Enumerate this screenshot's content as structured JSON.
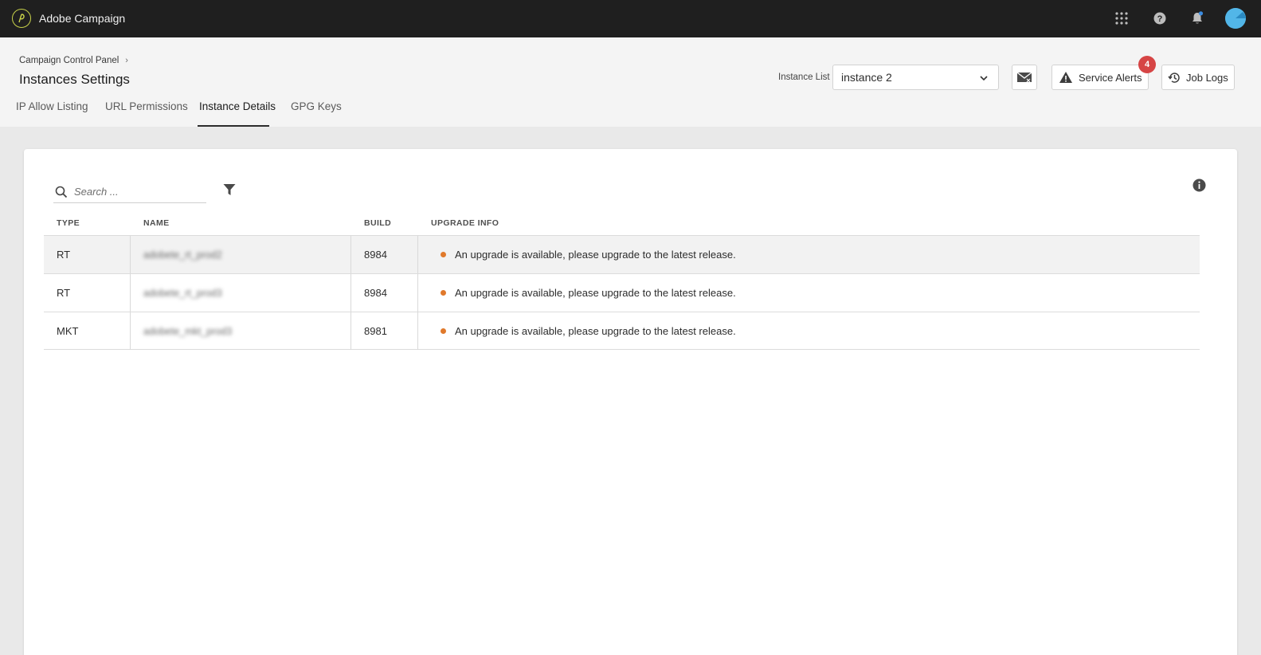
{
  "app": {
    "title": "Adobe Campaign"
  },
  "top_icons": [
    "apps-grid-icon",
    "help-icon",
    "bell-icon",
    "avatar"
  ],
  "header": {
    "breadcrumb": "Campaign Control Panel",
    "title": "Instances Settings",
    "instance_label": "Instance List",
    "instance_value": "instance 2",
    "service_alerts_label": "Service Alerts",
    "service_alerts_count": "4",
    "job_logs_label": "Job Logs"
  },
  "tabs": [
    {
      "label": "IP Allow Listing",
      "active": false
    },
    {
      "label": "URL Permissions",
      "active": false
    },
    {
      "label": "Instance Details",
      "active": true
    },
    {
      "label": "GPG Keys",
      "active": false
    }
  ],
  "search": {
    "placeholder": "Search ..."
  },
  "table": {
    "columns": [
      "TYPE",
      "NAME",
      "BUILD",
      "UPGRADE INFO"
    ],
    "rows": [
      {
        "type": "RT",
        "name": "adobete_rt_prod2",
        "build": "8984",
        "upgrade": "An upgrade is available, please upgrade to the latest release."
      },
      {
        "type": "RT",
        "name": "adobete_rt_prod3",
        "build": "8984",
        "upgrade": "An upgrade is available, please upgrade to the latest release."
      },
      {
        "type": "MKT",
        "name": "adobete_mkt_prod3",
        "build": "8981",
        "upgrade": "An upgrade is available, please upgrade to the latest release."
      }
    ]
  },
  "colors": {
    "topbar": "#1f1f1f",
    "badge": "#d64545",
    "status_dot": "#e0792b",
    "avatar": "#52b6e8"
  }
}
